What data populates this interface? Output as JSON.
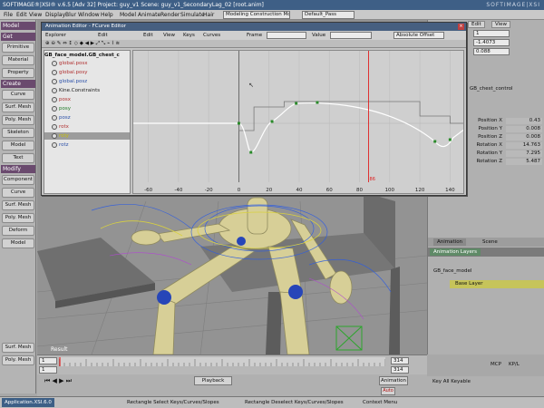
{
  "app": {
    "title": "SOFTIMAGE®|XSI® v.6.5 [Adv 32] Project: guy_v1 Scene: guy_v1_SecondaryLag_02 [root.anim]",
    "brand": "SOFTIMAGE|XSI",
    "menus": [
      "File",
      "Edit",
      "View",
      "Display",
      "Blur",
      "Window",
      "Help",
      "Model",
      "Animate",
      "Render",
      "Simulate",
      "Hair"
    ],
    "mode_dropdown": "Modeling Construction Mode",
    "pass_dropdown": "Default_Pass"
  },
  "left_toolbar": {
    "sections": [
      {
        "header": "Model",
        "buttons": []
      },
      {
        "header": "Get",
        "buttons": [
          "Primitive",
          "Material",
          "Property"
        ]
      },
      {
        "header": "Create",
        "buttons": [
          "Curve",
          "Surf. Mesh",
          "Poly. Mesh",
          "Skeleton",
          "Model",
          "Text"
        ]
      },
      {
        "header": "Modify",
        "buttons": [
          "Component",
          "Curve",
          "Surf. Mesh",
          "Poly. Mesh",
          "Deform",
          "Model"
        ]
      }
    ],
    "bottom_buttons": [
      "Surf. Mesh",
      "Poly. Mesh"
    ]
  },
  "animation_editor": {
    "title": "Animation Editor - FCurve Editor",
    "menus": [
      "Explorer",
      "Edit",
      "Edit",
      "View",
      "Keys",
      "Curves"
    ],
    "frame_label": "Frame",
    "frame_value": "",
    "value_label": "Value",
    "value_value": "",
    "offset_dropdown": "Absolute Offset",
    "explorer_root": "GB_face_model.GB_chest_c",
    "tree": [
      {
        "label": "global.posx",
        "color": "#b03030"
      },
      {
        "label": "global.posy",
        "color": "#b03030"
      },
      {
        "label": "global.posz",
        "color": "#2a4fa8"
      },
      {
        "label": "Kine.Constraints",
        "color": "#222222"
      },
      {
        "label": "posx",
        "color": "#b03030"
      },
      {
        "label": "posy",
        "color": "#1d7a26"
      },
      {
        "label": "posz",
        "color": "#2a4fa8"
      },
      {
        "label": "rotx",
        "color": "#b03030"
      },
      {
        "label": "roty",
        "color": "#c9c000"
      },
      {
        "label": "rotz",
        "color": "#2a4fa8"
      }
    ],
    "selected_index": 8,
    "graph": {
      "x_ticks": [
        "-60",
        "-40",
        "-20",
        "0",
        "20",
        "40",
        "60",
        "80",
        "100",
        "120",
        "140"
      ],
      "current_frame_line": 86,
      "current_frame_label": "86"
    }
  },
  "right_panel": {
    "tabs": [
      "Edit",
      "View"
    ],
    "fields": [
      "1",
      "-1.4073",
      "0.088"
    ],
    "object_name": "GB_chest_control",
    "params": [
      {
        "label": "Position X",
        "value": "0.43"
      },
      {
        "label": "Position Y",
        "value": "0.008"
      },
      {
        "label": "Position Z",
        "value": "0.008"
      },
      {
        "label": "Rotation X",
        "value": "14.763"
      },
      {
        "label": "Rotation Y",
        "value": "7.295"
      },
      {
        "label": "Rotation Z",
        "value": "5.487"
      }
    ],
    "animation_tabs": [
      "Animation",
      "Scene"
    ],
    "animation_layers_title": "Animation Layers",
    "layers_root": "GB_face_model",
    "layers": [
      "Base Layer"
    ]
  },
  "viewport": {
    "label": "Result"
  },
  "timeline": {
    "start": "1",
    "end_fields": [
      "314",
      "314"
    ],
    "current": "1"
  },
  "bottom": {
    "playback": "Playback",
    "animation": "Animation",
    "auto": "Auto",
    "key_all_keyable": "Key All Keyable",
    "mcp": "MCP",
    "kpl": "KP/L",
    "status_left": "Application.XSI.6.0",
    "hints": [
      "Rectangle Select Keys/Curves/Slopes",
      "Rectangle Deselect Keys/Curves/Slopes",
      "Context Menu"
    ]
  },
  "colors": {
    "title_blue": "#3e5f86",
    "toolbar_purple": "#6a4a6e",
    "current_frame": "#e02020",
    "curve_white": "#ffffff",
    "graph_bg": "#cfcfcf",
    "layers_green": "#5f8a67"
  }
}
